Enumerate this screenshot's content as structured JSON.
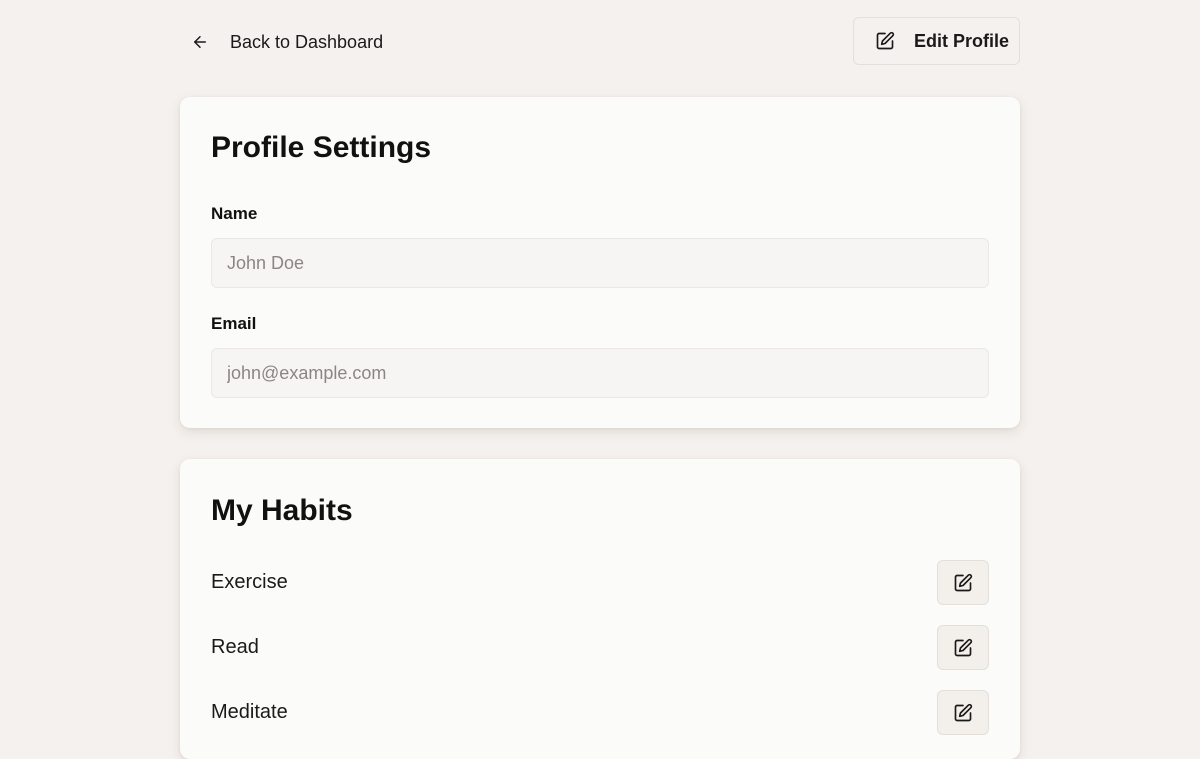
{
  "header": {
    "back_label": "Back to Dashboard",
    "back_icon": "arrow-left-icon",
    "edit_profile_label": "Edit Profile",
    "edit_profile_icon": "edit-icon"
  },
  "profile": {
    "title": "Profile Settings",
    "name_label": "Name",
    "name_placeholder": "John Doe",
    "name_value": "",
    "email_label": "Email",
    "email_placeholder": "john@example.com",
    "email_value": ""
  },
  "habits": {
    "title": "My Habits",
    "items": [
      {
        "name": "Exercise",
        "edit_icon": "edit-icon"
      },
      {
        "name": "Read",
        "edit_icon": "edit-icon"
      },
      {
        "name": "Meditate",
        "edit_icon": "edit-icon"
      }
    ]
  },
  "colors": {
    "background": "#f5f1ee",
    "card": "#fbfbfa",
    "input_bg": "#f7f5f3",
    "text": "#1a1a1a",
    "placeholder": "#8a8683",
    "border": "#e4dfda"
  }
}
